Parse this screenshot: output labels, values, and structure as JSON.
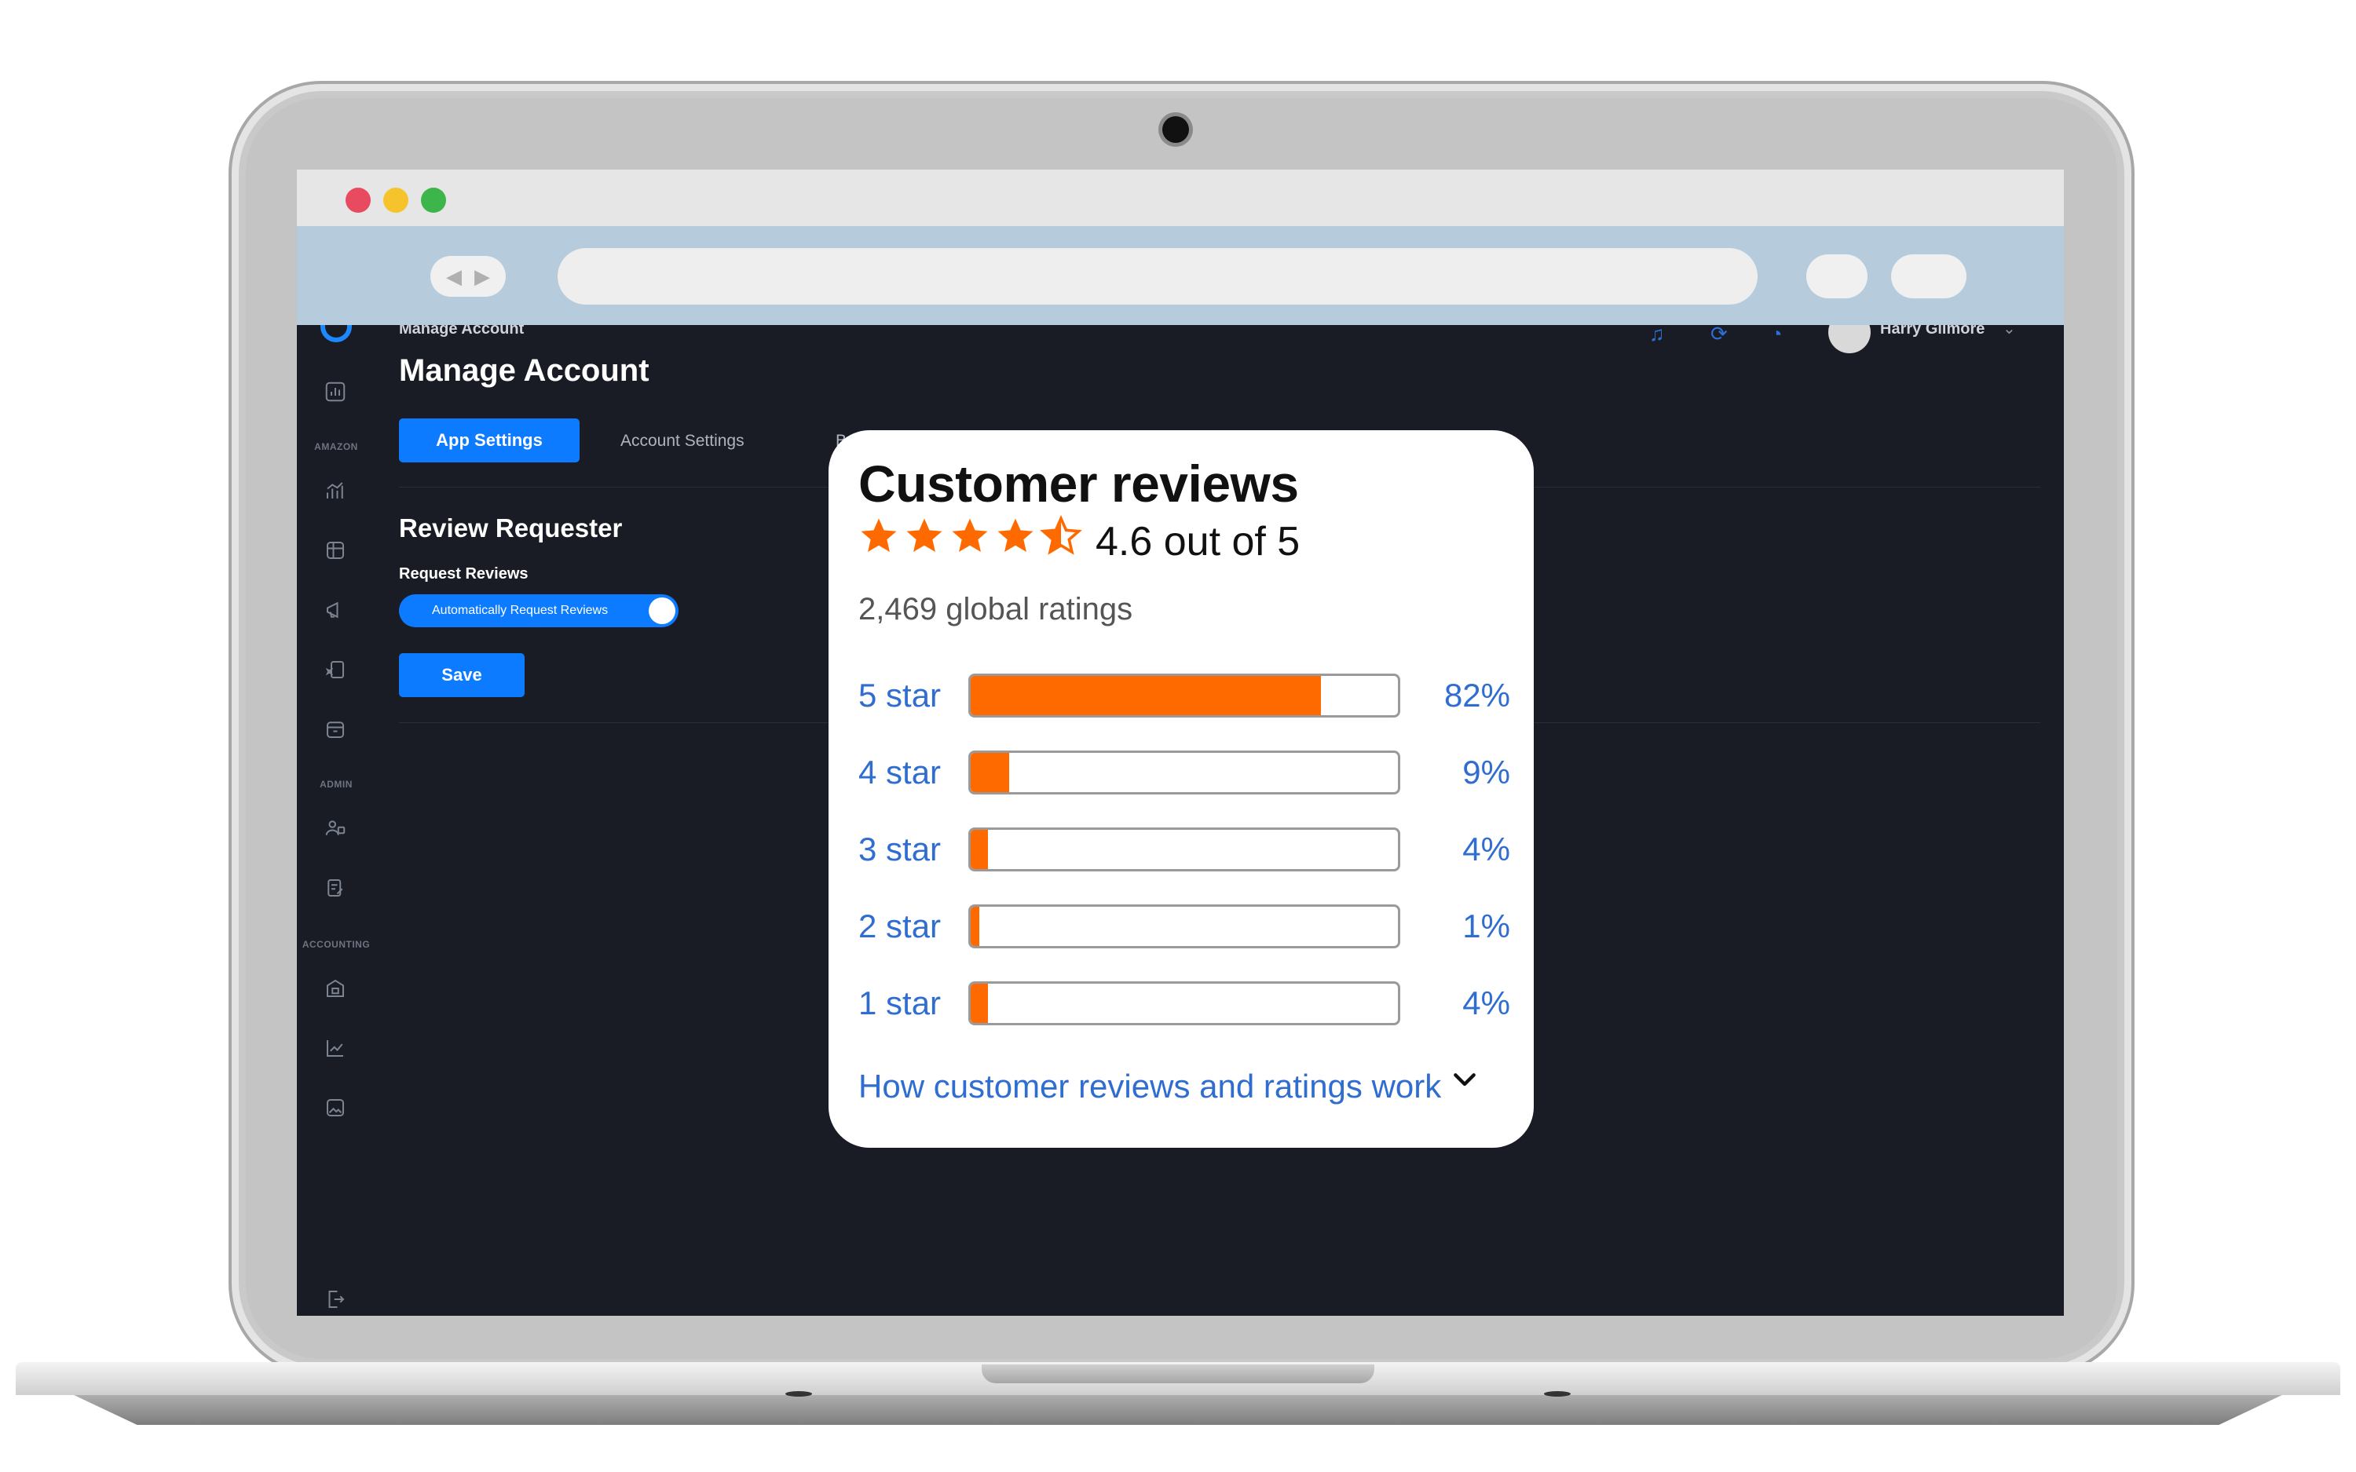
{
  "header": {
    "breadcrumb": "Manage Account",
    "user_name": "Harry Gilmore"
  },
  "sidebar": {
    "section_labels": [
      "AMAZON",
      "ADMIN",
      "ACCOUNTING"
    ]
  },
  "page": {
    "title": "Manage Account",
    "tabs": [
      {
        "label": "App Settings",
        "active": true
      },
      {
        "label": "Account Settings",
        "active": false
      },
      {
        "label": "B",
        "active": false
      }
    ],
    "section_title": "Review Requester",
    "field_label": "Request Reviews",
    "toggle_label": "Automatically Request Reviews",
    "toggle_on": true,
    "save_label": "Save"
  },
  "reviews": {
    "title": "Customer reviews",
    "rating_value": 4.6,
    "rating_text": "4.6 out of 5",
    "global_ratings": "2,469 global ratings",
    "rows": [
      {
        "label": "5 star",
        "percent_text": "82%",
        "percent": 82
      },
      {
        "label": "4 star",
        "percent_text": "9%",
        "percent": 9
      },
      {
        "label": "3 star",
        "percent_text": "4%",
        "percent": 4
      },
      {
        "label": "2 star",
        "percent_text": "1%",
        "percent": 1
      },
      {
        "label": "1 star",
        "percent_text": "4%",
        "percent": 4
      }
    ],
    "how_link": "How customer reviews and ratings work"
  },
  "colors": {
    "accent": "#0d7bff",
    "star": "#ff6a00",
    "link": "#2f6dd0",
    "app_background": "#191c24"
  }
}
